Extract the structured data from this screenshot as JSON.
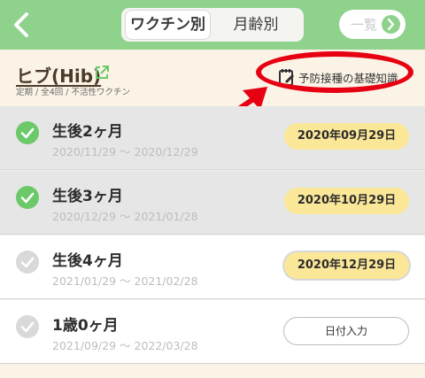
{
  "header": {
    "tabs": [
      {
        "label": "ワクチン別",
        "active": true
      },
      {
        "label": "月齢別",
        "active": false
      }
    ],
    "list_button_label": "一覧",
    "bg_color": "#8fd28c"
  },
  "vaccine": {
    "title": "ヒブ(Hib)",
    "subtitle": "定期 / 全4回 / 不活性ワクチン",
    "basic_knowledge_link": "予防接種の基礎知識"
  },
  "doses": [
    {
      "age": "生後2ヶ月",
      "range": "2020/11/29 〜 2020/12/29",
      "status": "done",
      "date": "2020年09月29日"
    },
    {
      "age": "生後3ヶ月",
      "range": "2020/12/29 〜 2021/01/28",
      "status": "done",
      "date": "2020年10月29日"
    },
    {
      "age": "生後4ヶ月",
      "range": "2021/01/29 〜 2021/02/28",
      "status": "todo",
      "date": "2020年12月29日"
    },
    {
      "age": "1歳0ヶ月",
      "range": "2021/09/29 〜 2022/03/28",
      "status": "todo",
      "date_input_label": "日付入力"
    }
  ],
  "colors": {
    "done_check": "#6cc96a",
    "todo_check": "#d9d9d9",
    "date_pill": "#fbe798",
    "annotation_red": "#e60012"
  }
}
